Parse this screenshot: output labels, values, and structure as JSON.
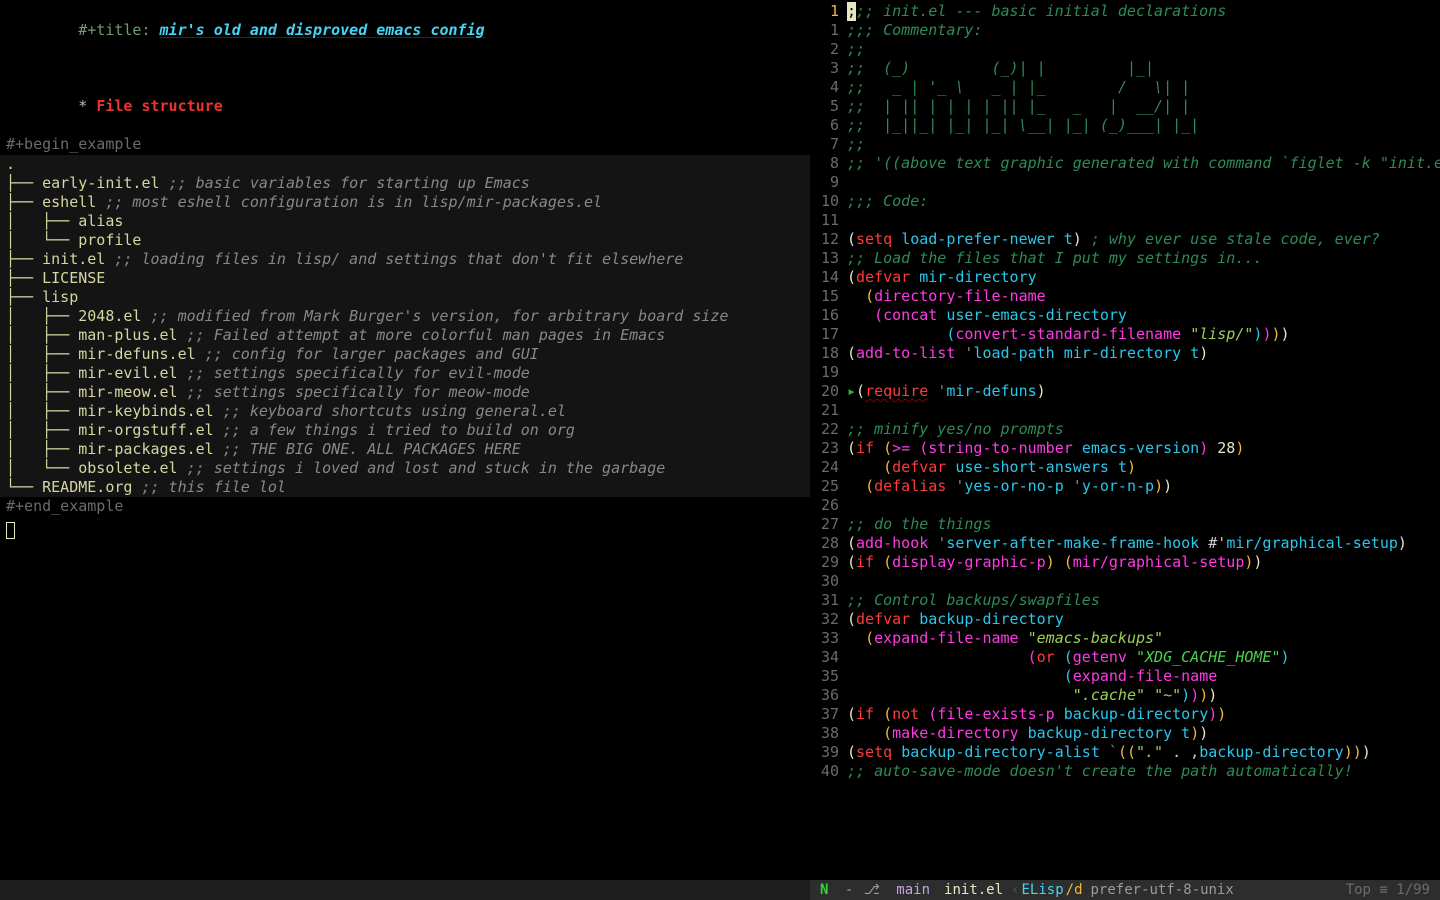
{
  "left": {
    "title_prefix": "#+title: ",
    "title": "mir's old and disproved emacs config",
    "heading_star": "* ",
    "heading": "File structure",
    "begin_example": "#+begin_example",
    "end_example": "#+end_example",
    "tree": [
      ".",
      "├── early-init.el ;; basic variables for starting up Emacs",
      "├── eshell ;; most eshell configuration is in lisp/mir-packages.el",
      "│   ├── alias",
      "│   └── profile",
      "├── init.el ;; loading files in lisp/ and settings that don't fit elsewhere",
      "├── LICENSE",
      "├── lisp",
      "│   ├── 2048.el ;; modified from Mark Burger's version, for arbitrary board size",
      "│   ├── man-plus.el ;; Failed attempt at more colorful man pages in Emacs",
      "│   ├── mir-defuns.el ;; config for larger packages and GUI",
      "│   ├── mir-evil.el ;; settings specifically for evil-mode",
      "│   ├── mir-meow.el ;; settings specifically for meow-mode",
      "│   ├── mir-keybinds.el ;; keyboard shortcuts using general.el",
      "│   ├── mir-orgstuff.el ;; a few things i tried to build on org",
      "│   ├── mir-packages.el ;; THE BIG ONE. ALL PACKAGES HERE",
      "│   └── obsolete.el ;; settings i loved and lost and stuck in the garbage",
      "└── README.org ;; this file lol"
    ]
  },
  "right": {
    "current_line": 1,
    "lines": [
      {
        "n": 1,
        "tokens": [
          [
            "cursor",
            ";"
          ],
          [
            "comment",
            ";; init.el --- basic initial declarations"
          ]
        ]
      },
      {
        "n": 1,
        "rel": true,
        "tokens": [
          [
            "comment",
            ";;; Commentary:"
          ]
        ]
      },
      {
        "n": 2,
        "rel": true,
        "tokens": [
          [
            "comment",
            ";;"
          ]
        ]
      },
      {
        "n": 3,
        "rel": true,
        "tokens": [
          [
            "comment",
            ";;  (_)         (_)| |         |_|"
          ]
        ]
      },
      {
        "n": 4,
        "rel": true,
        "tokens": [
          [
            "comment",
            ";;   _ | '_ \\   _ | |_        /   \\| |"
          ]
        ]
      },
      {
        "n": 5,
        "rel": true,
        "tokens": [
          [
            "comment",
            ";;  | || | | | | || |_   _   |  __/| |"
          ]
        ]
      },
      {
        "n": 6,
        "rel": true,
        "tokens": [
          [
            "comment",
            ";;  |_||_| |_| |_| \\__| |_| (_)___| |_|"
          ]
        ]
      },
      {
        "n": 7,
        "rel": true,
        "tokens": [
          [
            "comment",
            ";;"
          ]
        ]
      },
      {
        "n": 8,
        "rel": true,
        "tokens": [
          [
            "comment",
            ";; '((above text graphic generated with command `figlet -k \"init.el\"'))"
          ]
        ]
      },
      {
        "n": 9,
        "rel": true,
        "tokens": []
      },
      {
        "n": 10,
        "rel": true,
        "tokens": [
          [
            "comment",
            ";;; Code:"
          ]
        ]
      },
      {
        "n": 11,
        "rel": true,
        "tokens": []
      },
      {
        "n": 12,
        "rel": true,
        "tokens": [
          [
            "paren",
            "("
          ],
          [
            "keyword",
            "setq"
          ],
          [
            "plain",
            " "
          ],
          [
            "var",
            "load-prefer-newer"
          ],
          [
            "plain",
            " "
          ],
          [
            "t",
            "t"
          ],
          [
            "paren",
            ")"
          ],
          [
            "plain",
            " "
          ],
          [
            "comment",
            "; why ever use stale code, ever?"
          ]
        ]
      },
      {
        "n": 13,
        "rel": true,
        "tokens": [
          [
            "comment",
            ";; Load the files that I put my settings in..."
          ]
        ]
      },
      {
        "n": 14,
        "rel": true,
        "tokens": [
          [
            "paren",
            "("
          ],
          [
            "keyword",
            "defvar"
          ],
          [
            "plain",
            " "
          ],
          [
            "var",
            "mir-directory"
          ]
        ]
      },
      {
        "n": 15,
        "rel": true,
        "tokens": [
          [
            "plain",
            "  "
          ],
          [
            "pareny",
            "("
          ],
          [
            "func",
            "directory-file-name"
          ]
        ]
      },
      {
        "n": 16,
        "rel": true,
        "tokens": [
          [
            "plain",
            "   "
          ],
          [
            "parenp",
            "("
          ],
          [
            "func",
            "concat"
          ],
          [
            "plain",
            " "
          ],
          [
            "var",
            "user-emacs-directory"
          ]
        ]
      },
      {
        "n": 17,
        "rel": true,
        "tokens": [
          [
            "plain",
            "           "
          ],
          [
            "parenb",
            "("
          ],
          [
            "func",
            "convert-standard-filename"
          ],
          [
            "plain",
            " "
          ],
          [
            "string",
            "\"lisp/\""
          ],
          [
            "parenb",
            ")"
          ],
          [
            "parenp",
            ")"
          ],
          [
            "pareny",
            ")"
          ],
          [
            "paren",
            ")"
          ]
        ]
      },
      {
        "n": 18,
        "rel": true,
        "tokens": [
          [
            "paren",
            "("
          ],
          [
            "func",
            "add-to-list"
          ],
          [
            "plain",
            " "
          ],
          [
            "quote",
            "'"
          ],
          [
            "var",
            "load-path"
          ],
          [
            "plain",
            " "
          ],
          [
            "var",
            "mir-directory"
          ],
          [
            "plain",
            " "
          ],
          [
            "t",
            "t"
          ],
          [
            "paren",
            ")"
          ]
        ]
      },
      {
        "n": 19,
        "rel": true,
        "tokens": []
      },
      {
        "n": 20,
        "rel": true,
        "bullet": true,
        "tokens": [
          [
            "paren",
            "("
          ],
          [
            "keyword-u",
            "require"
          ],
          [
            "plain",
            " "
          ],
          [
            "quote",
            "'"
          ],
          [
            "var",
            "mir-defuns"
          ],
          [
            "paren",
            ")"
          ]
        ]
      },
      {
        "n": 21,
        "rel": true,
        "tokens": []
      },
      {
        "n": 22,
        "rel": true,
        "tokens": [
          [
            "comment",
            ";; minify yes/no prompts"
          ]
        ]
      },
      {
        "n": 23,
        "rel": true,
        "tokens": [
          [
            "paren",
            "("
          ],
          [
            "keyword",
            "if"
          ],
          [
            "plain",
            " "
          ],
          [
            "pareny",
            "("
          ],
          [
            "func",
            ">="
          ],
          [
            "plain",
            " "
          ],
          [
            "parenp",
            "("
          ],
          [
            "func",
            "string-to-number"
          ],
          [
            "plain",
            " "
          ],
          [
            "var",
            "emacs-version"
          ],
          [
            "parenp",
            ")"
          ],
          [
            "plain",
            " "
          ],
          [
            "num",
            "28"
          ],
          [
            "pareny",
            ")"
          ]
        ]
      },
      {
        "n": 24,
        "rel": true,
        "tokens": [
          [
            "plain",
            "    "
          ],
          [
            "pareny",
            "("
          ],
          [
            "keyword",
            "defvar"
          ],
          [
            "plain",
            " "
          ],
          [
            "var",
            "use-short-answers"
          ],
          [
            "plain",
            " "
          ],
          [
            "t",
            "t"
          ],
          [
            "pareny",
            ")"
          ]
        ]
      },
      {
        "n": 25,
        "rel": true,
        "tokens": [
          [
            "plain",
            "  "
          ],
          [
            "pareny",
            "("
          ],
          [
            "keyword",
            "defalias"
          ],
          [
            "plain",
            " "
          ],
          [
            "quote",
            "'"
          ],
          [
            "var",
            "yes-or-no-p"
          ],
          [
            "plain",
            " "
          ],
          [
            "quote",
            "'"
          ],
          [
            "var",
            "y-or-n-p"
          ],
          [
            "pareny",
            ")"
          ],
          [
            "paren",
            ")"
          ]
        ]
      },
      {
        "n": 26,
        "rel": true,
        "tokens": []
      },
      {
        "n": 27,
        "rel": true,
        "tokens": [
          [
            "comment",
            ";; do the things"
          ]
        ]
      },
      {
        "n": 28,
        "rel": true,
        "tokens": [
          [
            "paren",
            "("
          ],
          [
            "func",
            "add-hook"
          ],
          [
            "plain",
            " "
          ],
          [
            "quote",
            "'"
          ],
          [
            "var",
            "server-after-make-frame-hook"
          ],
          [
            "plain",
            " #'"
          ],
          [
            "var",
            "mir/graphical-setup"
          ],
          [
            "paren",
            ")"
          ]
        ]
      },
      {
        "n": 29,
        "rel": true,
        "tokens": [
          [
            "paren",
            "("
          ],
          [
            "keyword",
            "if"
          ],
          [
            "plain",
            " "
          ],
          [
            "pareny",
            "("
          ],
          [
            "func",
            "display-graphic-p"
          ],
          [
            "pareny",
            ")"
          ],
          [
            "plain",
            " "
          ],
          [
            "pareny",
            "("
          ],
          [
            "func",
            "mir/graphical-setup"
          ],
          [
            "pareny",
            ")"
          ],
          [
            "paren",
            ")"
          ]
        ]
      },
      {
        "n": 30,
        "rel": true,
        "tokens": []
      },
      {
        "n": 31,
        "rel": true,
        "tokens": [
          [
            "comment",
            ";; Control backups/swapfiles"
          ]
        ]
      },
      {
        "n": 32,
        "rel": true,
        "tokens": [
          [
            "paren",
            "("
          ],
          [
            "keyword",
            "defvar"
          ],
          [
            "plain",
            " "
          ],
          [
            "var",
            "backup-directory"
          ]
        ]
      },
      {
        "n": 33,
        "rel": true,
        "tokens": [
          [
            "plain",
            "  "
          ],
          [
            "pareny",
            "("
          ],
          [
            "func",
            "expand-file-name"
          ],
          [
            "plain",
            " "
          ],
          [
            "string",
            "\"emacs-backups\""
          ]
        ]
      },
      {
        "n": 34,
        "rel": true,
        "tokens": [
          [
            "plain",
            "                    "
          ],
          [
            "parenp",
            "("
          ],
          [
            "keyword",
            "or"
          ],
          [
            "plain",
            " "
          ],
          [
            "parenb",
            "("
          ],
          [
            "func",
            "getenv"
          ],
          [
            "plain",
            " "
          ],
          [
            "string-c",
            "\"XDG_CACHE_HOME\""
          ],
          [
            "parenb",
            ")"
          ]
        ]
      },
      {
        "n": 35,
        "rel": true,
        "tokens": [
          [
            "plain",
            "                        "
          ],
          [
            "parenb",
            "("
          ],
          [
            "func",
            "expand-file-name"
          ]
        ]
      },
      {
        "n": 36,
        "rel": true,
        "tokens": [
          [
            "plain",
            "                         "
          ],
          [
            "string",
            "\".cache\""
          ],
          [
            "plain",
            " "
          ],
          [
            "string",
            "\"~\""
          ],
          [
            "parenb",
            ")"
          ],
          [
            "parenp",
            ")"
          ],
          [
            "pareny",
            ")"
          ],
          [
            "paren",
            ")"
          ]
        ]
      },
      {
        "n": 37,
        "rel": true,
        "tokens": [
          [
            "paren",
            "("
          ],
          [
            "keyword",
            "if"
          ],
          [
            "plain",
            " "
          ],
          [
            "pareny",
            "("
          ],
          [
            "keyword",
            "not"
          ],
          [
            "plain",
            " "
          ],
          [
            "parenp",
            "("
          ],
          [
            "func",
            "file-exists-p"
          ],
          [
            "plain",
            " "
          ],
          [
            "var",
            "backup-directory"
          ],
          [
            "parenp",
            ")"
          ],
          [
            "pareny",
            ")"
          ]
        ]
      },
      {
        "n": 38,
        "rel": true,
        "tokens": [
          [
            "plain",
            "    "
          ],
          [
            "pareny",
            "("
          ],
          [
            "func",
            "make-directory"
          ],
          [
            "plain",
            " "
          ],
          [
            "var",
            "backup-directory"
          ],
          [
            "plain",
            " "
          ],
          [
            "t",
            "t"
          ],
          [
            "pareny",
            ")"
          ],
          [
            "paren",
            ")"
          ]
        ]
      },
      {
        "n": 39,
        "rel": true,
        "tokens": [
          [
            "paren",
            "("
          ],
          [
            "keyword",
            "setq"
          ],
          [
            "plain",
            " "
          ],
          [
            "var",
            "backup-directory-alist"
          ],
          [
            "plain",
            " "
          ],
          [
            "quote",
            "`"
          ],
          [
            "pareny",
            "(("
          ],
          [
            "string",
            "\".\""
          ],
          [
            "plain",
            " . ,"
          ],
          [
            "var",
            "backup-directory"
          ],
          [
            "pareny",
            "))"
          ],
          [
            "paren",
            ")"
          ]
        ]
      },
      {
        "n": 40,
        "rel": true,
        "tokens": [
          [
            "comment",
            ";; auto-save-mode doesn't create the path automatically!"
          ]
        ]
      }
    ]
  },
  "modeline": {
    "state": "N",
    "sep1": " - ",
    "branch_icon": "⎇",
    "branch": " main",
    "file": "init.el",
    "angle": " ‹ ",
    "mode": "ELisp",
    "mode_suffix": "/d",
    "encoding": "prefer-utf-8-unix",
    "pos": "Top ≡ 1/99"
  }
}
